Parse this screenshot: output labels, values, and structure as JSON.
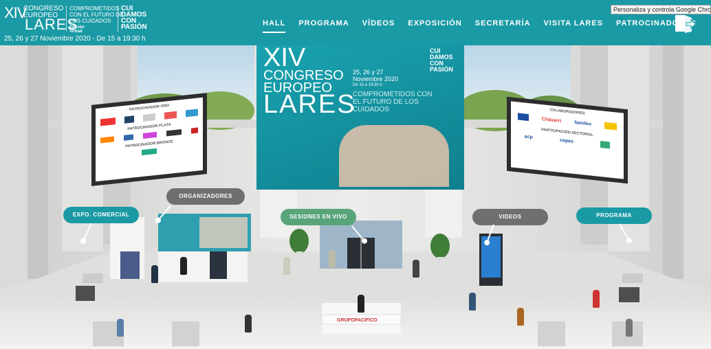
{
  "header": {
    "logo": {
      "xiv": "XIV",
      "congreso_europeo": "CONGRESO EUROPEO",
      "lares": "LARES",
      "comprometidos": "COMPROMETIDOS CON EL FUTURO DE LOS CUIDADOS",
      "edicion": "Edición Virtual",
      "cui_damos": "CUI DAMOS CON PASIÓN"
    },
    "dates": "25, 26 y 27 Noviembre 2020 - De 15 a 19:30 h",
    "nav": [
      {
        "label": "HALL",
        "active": true
      },
      {
        "label": "PROGRAMA"
      },
      {
        "label": "VÍDEOS"
      },
      {
        "label": "EXPOSICIÓN"
      },
      {
        "label": "SECRETARÍA"
      },
      {
        "label": "VISITA LARES"
      },
      {
        "label": "PATROCINADORES"
      }
    ],
    "tooltip": "Personaliza y controla Google Chrome"
  },
  "banner": {
    "xiv": "XIV",
    "congreso": "CONGRESO",
    "europeo": "EUROPEO",
    "lares": "LARES",
    "dates": "25, 26 y 27",
    "month": "Noviembre 2020",
    "hours": "De 15 a 19:30 h",
    "comprometidos": "COMPROMETIDOS CON EL FUTURO DE LOS CUIDADOS",
    "cui": "CUI DAMOS CON PASIÓN"
  },
  "left_board": {
    "oro": "PATROCINADOR ORO",
    "plata": "PATROCINADOR PLATA",
    "bronce": "PATROCINADOR BRONCE"
  },
  "right_board": {
    "colaboradores": "COLABORADORES",
    "sectorial": "PARTICIPACIÓN SECTORIAL",
    "logos": [
      "Chávarri",
      "famileo",
      "acp",
      "cepes"
    ]
  },
  "hotspots": {
    "expo": "EXPO. COMERCIAL",
    "organizadores": "ORGANIZADORES",
    "sesiones": "SESIONES EN VIVO",
    "videos": "VIDEOS",
    "programa": "PROGRAMA"
  },
  "reception": "GRUPOPACIFICO",
  "colors": {
    "teal": "#1a9aa5",
    "green_pill": "#5aa47a",
    "grey_pill": "#6f6f6f"
  }
}
